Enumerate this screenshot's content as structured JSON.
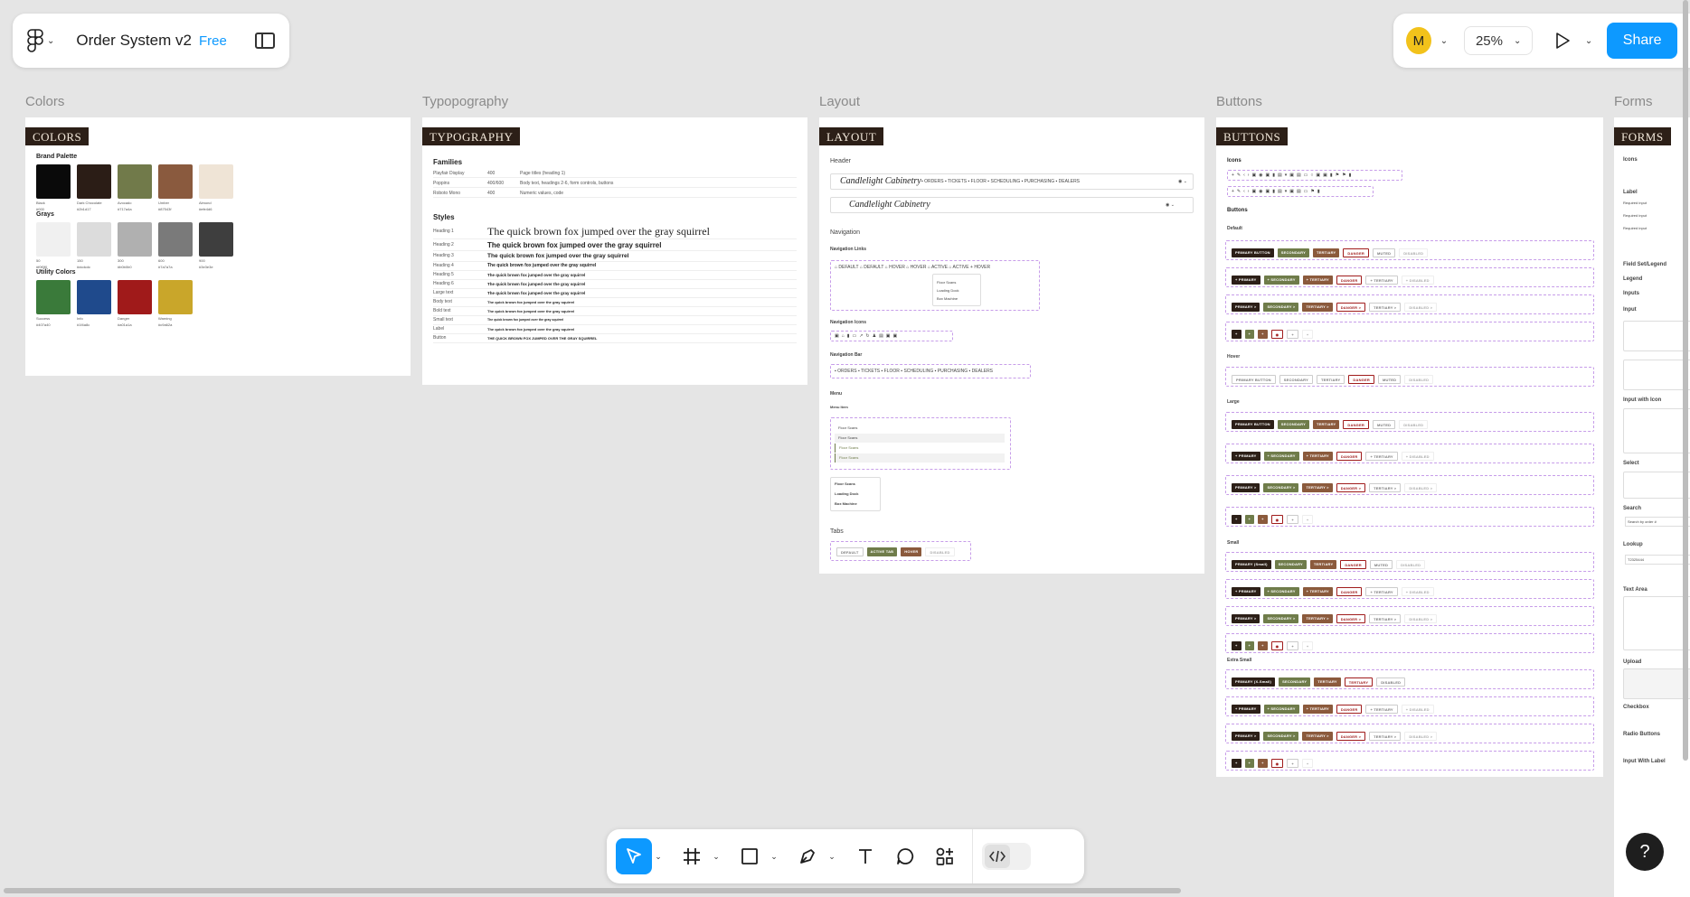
{
  "file": {
    "name": "Order System v2",
    "plan": "Free"
  },
  "topbar": {
    "avatar": "M",
    "zoom": "25%",
    "share": "Share"
  },
  "frames": {
    "colors": {
      "label": "Colors",
      "tag": "COLORS",
      "groups": [
        {
          "title": "Brand Palette",
          "swatches": [
            {
              "color": "#0a0a0a",
              "name": "Black",
              "hex": "#000"
            },
            {
              "color": "#2b1d16",
              "name": "Dark Chocolate",
              "hex": "#2b1d17"
            },
            {
              "color": "#717a4a",
              "name": "Avocado",
              "hex": "#717a4a"
            },
            {
              "color": "#8a5a3e",
              "name": "Umber",
              "hex": "#87543f"
            },
            {
              "color": "#efe4d6",
              "name": "Almond",
              "hex": "#efe4d6"
            }
          ]
        },
        {
          "title": "Grays",
          "swatches": [
            {
              "color": "#f0f0f0",
              "name": "50",
              "hex": "#f0f0f0"
            },
            {
              "color": "#dcdcdc",
              "name": "150",
              "hex": "#dcdcdc"
            },
            {
              "color": "#b0b0b0",
              "name": "300",
              "hex": "#b0b0b0"
            },
            {
              "color": "#7a7a7a",
              "name": "600",
              "hex": "#7a7a7a"
            },
            {
              "color": "#3e3e3e",
              "name": "900",
              "hex": "#3e3e3e"
            }
          ]
        },
        {
          "title": "Utility Colors",
          "swatches": [
            {
              "color": "#3a7a3a",
              "name": "Success",
              "hex": "#407a40"
            },
            {
              "color": "#1f4a8c",
              "name": "Info",
              "hex": "#1f4a8c"
            },
            {
              "color": "#a01a1a",
              "name": "Danger",
              "hex": "#a01a1a"
            },
            {
              "color": "#c9a62a",
              "name": "Warning",
              "hex": "#c9a62a"
            }
          ]
        }
      ]
    },
    "typography": {
      "label": "Typopography",
      "tag": "TYPOGRAPHY",
      "families_title": "Families",
      "families": [
        {
          "name": "Playfair Display",
          "weight": "400",
          "usage": "Page titles (heading 1)"
        },
        {
          "name": "Poppins",
          "weight": "400/600",
          "usage": "Body text, headings 2-6, form controls, buttons"
        },
        {
          "name": "Roboto Mono",
          "weight": "400",
          "usage": "Numeric values, code"
        }
      ],
      "styles_title": "Styles",
      "styles": [
        {
          "name": "Heading 1",
          "sample": "The quick brown fox jumped over the gray squirrel",
          "size": 12,
          "serif": true
        },
        {
          "name": "Heading 2",
          "sample": "The quick brown fox jumped over the gray squirrel",
          "size": 8
        },
        {
          "name": "Heading 3",
          "sample": "The quick brown fox jumped over the gray squirrel",
          "size": 6.5
        },
        {
          "name": "Heading 4",
          "sample": "The quick brown fox jumped over the gray squirrel",
          "size": 5
        },
        {
          "name": "Heading 5",
          "sample": "The quick brown fox jumped over the gray squirrel",
          "size": 4.5
        },
        {
          "name": "Heading 6",
          "sample": "The quick brown fox jumped over the gray squirrel",
          "size": 4.5
        },
        {
          "name": "Large text",
          "sample": "The quick brown fox jumped over the gray squirrel",
          "size": 4.5
        },
        {
          "name": "Body text",
          "sample": "The quick brown fox jumped over the gray squirrel",
          "size": 4
        },
        {
          "name": "Bold text",
          "sample": "The quick brown fox jumped over the gray squirrel",
          "size": 4
        },
        {
          "name": "Small text",
          "sample": "The quick brown fox jumped over the gray squirrel",
          "size": 3.5
        },
        {
          "name": "Label",
          "sample": "The quick brown fox jumped over the gray squirrel",
          "size": 4
        },
        {
          "name": "Button",
          "sample": "THE QUICK BROWN FOX JUMPED OVER THE GRAY SQUIRREL",
          "size": 4
        }
      ]
    },
    "layout": {
      "label": "Layout",
      "tag": "LAYOUT",
      "header": "Header",
      "brand": "Candlelight Cabinetry",
      "nav_items": [
        "ORDERS",
        "TICKETS",
        "FLOOR",
        "SCHEDULING",
        "PURCHASING",
        "DEALERS"
      ],
      "navigation": "Navigation",
      "nav_links": "Navigation Links",
      "link_states": [
        "DEFAULT",
        "DEFAULT",
        "HOVER",
        "HOVER",
        "ACTIVE",
        "ACTIVE + HOVER"
      ],
      "dropdown_items": [
        "Floor Scans",
        "Loading Dock",
        "Box Machine"
      ],
      "nav_icons": "Navigation Icons",
      "nav_bar": "Navigation Bar",
      "bar_items": [
        "ORDERS",
        "TICKETS",
        "FLOOR",
        "SCHEDULING",
        "PURCHASING",
        "DEALERS"
      ],
      "menu": "Menu",
      "menu_item": "Menu Item",
      "menu_items": [
        "Floor Scans",
        "Floor Scans",
        "Floor Scans",
        "Floor Scans"
      ],
      "menu_items2": [
        "Floor Scans",
        "Loading Dock",
        "Box Machine"
      ],
      "tabs": "Tabs",
      "tab_items": [
        "DEFAULT",
        "ACTIVE TAB",
        "HOVER",
        "DISABLED"
      ]
    },
    "buttons": {
      "label": "Buttons",
      "tag": "BUTTONS",
      "icons": "Icons",
      "buttons": "Buttons",
      "default": "Default",
      "hover": "Hover",
      "large": "Large",
      "small": "Small",
      "xsmall": "Extra Small",
      "row1": [
        "PRIMARY BUTTON",
        "SECONDARY",
        "TERTIARY",
        "DANGER",
        "MUTED",
        "DISABLED"
      ],
      "row_icon": [
        "+ PRIMARY",
        "+ SECONDARY",
        "+ TERTIARY",
        "DANGER",
        "+ TERTIARY",
        "+ DISABLED"
      ],
      "row_chev": [
        "PRIMARY >",
        "SECONDARY >",
        "TERTIARY >",
        "DANGER >",
        "TERTIARY >",
        "DISABLED >"
      ],
      "small_row1": [
        "PRIMARY (Small)",
        "SECONDARY",
        "TERTIARY",
        "DANGER",
        "MUTED",
        "DISABLED"
      ],
      "xs_row1": [
        "PRIMARY (X-Small)",
        "SECONDARY",
        "TERTIARY",
        "TERTIARY",
        "DISABLED"
      ]
    },
    "forms": {
      "label": "Forms",
      "tag": "FORMS",
      "items": [
        "Icons",
        "Label",
        "Field Set/Legend",
        "Legend",
        "Inputs",
        "Input",
        "Input with Icon",
        "Select",
        "Search",
        "Lookup",
        "Text Area",
        "Upload",
        "Checkbox",
        "Radio Buttons",
        "Input With Label"
      ],
      "required_input": "Required input",
      "search_placeholder": "Search by order #",
      "lookup_placeholder": "T2325444"
    }
  }
}
